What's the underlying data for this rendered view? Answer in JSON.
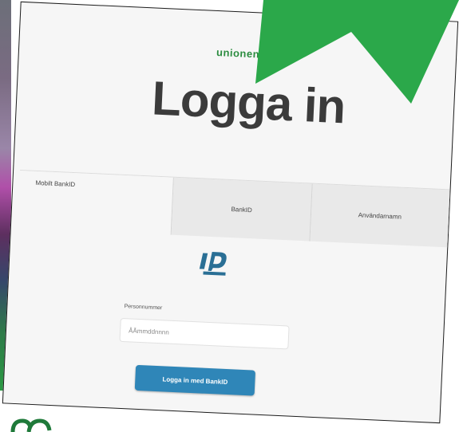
{
  "brand": {
    "name": "unionen"
  },
  "login": {
    "title": "Logga in",
    "tabs": [
      "Mobilt BankID",
      "BankID",
      "Användarnamn"
    ],
    "bankid_icon": "bankid-logo-icon",
    "personnummer": {
      "label": "Personnummer",
      "placeholder": "ÅÅmmddnnnn"
    },
    "submit_label": "Logga in med BankID"
  },
  "colors": {
    "brand_green": "#2ba84a",
    "button_blue": "#2f86b8",
    "title_gray": "#3b3b3b"
  }
}
